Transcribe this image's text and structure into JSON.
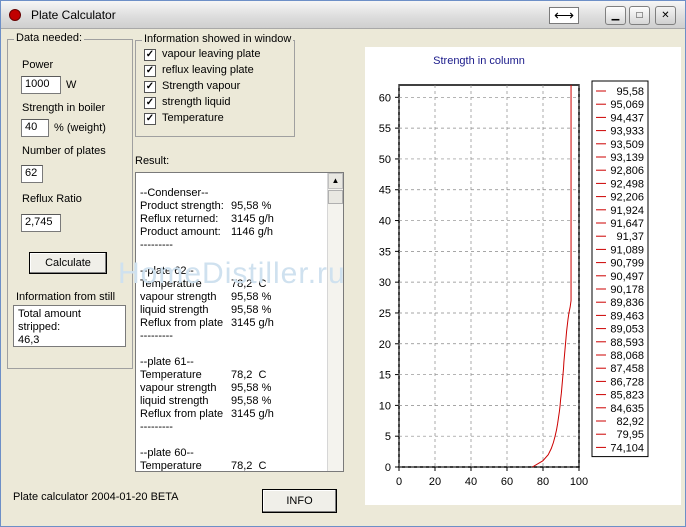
{
  "window": {
    "title": "Plate Calculator",
    "arrow_glyph": "⟷",
    "minimize_glyph": "▁",
    "maximize_glyph": "□",
    "close_glyph": "✕"
  },
  "data_needed": {
    "group_title": "Data needed:",
    "power_label": "Power",
    "power_value": "1000",
    "power_unit": "W",
    "strength_label": "Strength in  boiler",
    "strength_value": "40",
    "strength_unit": "% (weight)",
    "plates_label": "Number of plates",
    "plates_value": "62",
    "reflux_label": "Reflux Ratio",
    "reflux_value": "2,745",
    "calculate_label": "Calculate"
  },
  "info_window": {
    "group_title": "Information showed in window",
    "items": [
      {
        "label": "vapour leaving plate",
        "checked": true
      },
      {
        "label": "reflux leaving plate",
        "checked": true
      },
      {
        "label": "Strength vapour",
        "checked": true
      },
      {
        "label": "strength liquid",
        "checked": true
      },
      {
        "label": "Temperature",
        "checked": true
      }
    ]
  },
  "result": {
    "label": "Result:",
    "lines": [
      {
        "text": "--Condenser--",
        "value": ""
      },
      {
        "text": "Product strength:",
        "value": "95,58 %"
      },
      {
        "text": "Reflux returned:",
        "value": "3145 g/h"
      },
      {
        "text": "Product amount:",
        "value": "1146 g/h"
      },
      {
        "text": "---------",
        "value": ""
      },
      {
        "text": "",
        "value": ""
      },
      {
        "text": "--plate 62--",
        "value": ""
      },
      {
        "text": "Temperature",
        "value": "78,2  C"
      },
      {
        "text": "vapour strength",
        "value": "95,58 %"
      },
      {
        "text": "liquid strength",
        "value": "95,58 %"
      },
      {
        "text": "Reflux from plate",
        "value": "3145 g/h"
      },
      {
        "text": "---------",
        "value": ""
      },
      {
        "text": "",
        "value": ""
      },
      {
        "text": "--plate 61--",
        "value": ""
      },
      {
        "text": "Temperature",
        "value": "78,2  C"
      },
      {
        "text": "vapour strength",
        "value": "95,58 %"
      },
      {
        "text": "liquid strength",
        "value": "95,58 %"
      },
      {
        "text": "Reflux from plate",
        "value": "3145 g/h"
      },
      {
        "text": "---------",
        "value": ""
      },
      {
        "text": "",
        "value": ""
      },
      {
        "text": "--plate 60--",
        "value": ""
      },
      {
        "text": "Temperature",
        "value": "78,2  C"
      }
    ]
  },
  "still": {
    "group_title": "Information from still",
    "line1": "Total amount stripped:",
    "line2": "46,3"
  },
  "footer": {
    "version": "Plate calculator 2004-01-20 BETA",
    "info_label": "INFO"
  },
  "watermark": "HomeDistiller.ru",
  "chart_data": {
    "type": "line",
    "title": "Strength in column",
    "xlabel": "",
    "ylabel": "",
    "xlim": [
      0,
      100
    ],
    "ylim": [
      0,
      62
    ],
    "xticks": [
      "0",
      "20",
      "40",
      "60",
      "80",
      "100"
    ],
    "yticks": [
      "0",
      "5",
      "10",
      "15",
      "20",
      "25",
      "30",
      "35",
      "40",
      "45",
      "50",
      "55",
      "60"
    ],
    "grid": true,
    "line_color": "#cc0000",
    "series": [
      {
        "x": [
          74.1,
          79.9,
          82.9,
          84.6,
          85.8,
          86.7,
          87.5,
          88.1,
          88.6,
          89.1,
          89.5,
          89.8,
          90.2,
          90.5,
          90.8,
          91.1,
          91.4,
          91.6,
          91.9,
          92.2,
          92.5,
          92.8,
          93.1,
          93.5,
          93.9,
          94.4,
          95.1,
          95.58,
          95.58
        ],
        "y": [
          0,
          1,
          2,
          3,
          4,
          5,
          6,
          7,
          8,
          9,
          10,
          11,
          12,
          13,
          14,
          15,
          16,
          17,
          18,
          19,
          20,
          21,
          22,
          23,
          24,
          25,
          26,
          27,
          62
        ]
      }
    ],
    "legend_position": "right",
    "legend_values": [
      "95,58",
      "95,069",
      "94,437",
      "93,933",
      "93,509",
      "93,139",
      "92,806",
      "92,498",
      "92,206",
      "91,924",
      "91,647",
      "91,37",
      "91,089",
      "90,799",
      "90,497",
      "90,178",
      "89,836",
      "89,463",
      "89,053",
      "88,593",
      "88,068",
      "87,458",
      "86,728",
      "85,823",
      "84,635",
      "82,92",
      "79,95",
      "74,104"
    ]
  }
}
